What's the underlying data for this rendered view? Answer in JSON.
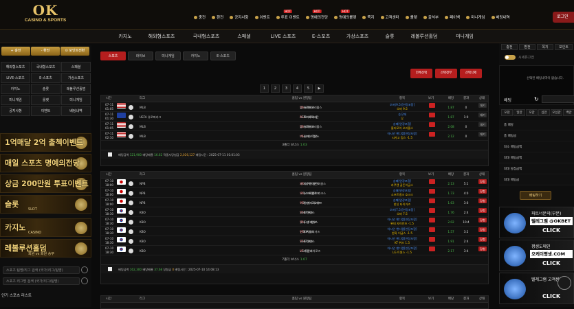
{
  "logo": {
    "big": "OK",
    "small": "CASINO & SPORTS"
  },
  "topnav": [
    {
      "label": "충전",
      "hot": ""
    },
    {
      "label": "환전",
      "hot": ""
    },
    {
      "label": "공지사항",
      "hot": ""
    },
    {
      "label": "이벤트",
      "hot": ""
    },
    {
      "label": "투표 이벤트",
      "hot": "HOT"
    },
    {
      "label": "명예의전당",
      "hot": "HOT"
    },
    {
      "label": "명예의룰렛",
      "hot": "HOT"
    },
    {
      "label": "쪽지",
      "hot": ""
    },
    {
      "label": "고객센터",
      "hot": ""
    },
    {
      "label": "룰렛",
      "hot": ""
    },
    {
      "label": "출석부",
      "hot": ""
    },
    {
      "label": "페이백",
      "hot": ""
    },
    {
      "label": "미니게임",
      "hot": ""
    },
    {
      "label": "베팅내역",
      "hot": ""
    }
  ],
  "login_label": "로그인",
  "mainnav": [
    "카지노",
    "해외형스포츠",
    "국내형스포츠",
    "스페셜",
    "LIVE 스포츠",
    "E-스포츠",
    "가상스포츠",
    "슬롯",
    "레볼루션홀덤",
    "미니게임"
  ],
  "left": {
    "top_buttons": [
      "+ 충전",
      "- 환전",
      "⊙ 포인트전환"
    ],
    "sports": [
      "해외형스포츠",
      "국내형스포츠",
      "스페셜",
      "LIVE-스포츠",
      "E-스포츠",
      "가상스포츠",
      "카지노",
      "슬롯",
      "레볼루션홀덤",
      "미니게임",
      "룰렛",
      "미니게임",
      "공지사항",
      "이벤트",
      "베팅내역"
    ],
    "banners": [
      {
        "title": "1억매달 2억 출첵이벤트",
        "sub": ""
      },
      {
        "title": "매일 스포츠 명예의전당",
        "sub": ""
      },
      {
        "title": "상금 200만원 투표이벤트",
        "sub": ""
      },
      {
        "title": "슬롯",
        "sub": "SLOT"
      },
      {
        "title": "카지노",
        "sub": "CASINO"
      },
      {
        "title": "레볼루션홀덤",
        "sub": "회원 vs 회원 승부"
      }
    ],
    "search1_placeholder": "스포츠 팀명/리그 검색 (국가/리그/팀명)",
    "search2_placeholder": "스포츠 리그명 검색 (국가/리그/팀명)",
    "popular_label": "인기 스포츠 리스트"
  },
  "tabs": [
    "스포츠",
    "라이브",
    "미니게임",
    "카지노",
    "E-스포츠"
  ],
  "red_buttons": [
    "전체선택",
    "선택정부",
    "선택삭제"
  ],
  "pager": [
    "1",
    "2",
    "3",
    "4",
    "5",
    "▶"
  ],
  "columns": [
    "시간",
    "리그",
    "홈팀 vs 원정팀",
    "항목",
    "보기",
    "배당",
    "결과",
    "상태"
  ],
  "table1": {
    "rows": [
      {
        "time": [
          "07-11",
          "01:05"
        ],
        "flag": "us",
        "league": "MLB",
        "home": "볼티모어 오리올스",
        "away": "뉴욕메츠",
        "sel": [
          "오버(9.5)[연장포함]",
          "오버 9.5"
        ],
        "odds": "1.87",
        "result": "0",
        "status": "대기"
      },
      {
        "time": [
          "07-11",
          "01:30"
        ],
        "flag": "eu",
        "league": "UEFA 유로파리그",
        "home": "AEK 라르나카",
        "away": "FK 파르티잔",
        "sel": [
          "승무패",
          "무"
        ],
        "odds": "1.87",
        "result": "1:0",
        "status": "대기"
      },
      {
        "time": [
          "07-11",
          "01:05"
        ],
        "flag": "us",
        "league": "MLB",
        "home": "볼티모어 오리올스",
        "away": "뉴욕메츠",
        "sel": [
          "승패[연장포함]",
          "볼티모어 오리올스"
        ],
        "odds": "2.08",
        "result": "0",
        "status": "대기"
      },
      {
        "time": [
          "07-11",
          "02:10"
        ],
        "flag": "us",
        "league": "MLB",
        "home": "미네소타 트윈스",
        "away": "시카고 컵스",
        "sel": [
          "아시안 핸디캡[연장포함]",
          "시카고 컵스 -1.5"
        ],
        "odds": "2.12",
        "result": "0",
        "status": "대기"
      }
    ],
    "bonus": "3폴더 보너스",
    "bonus_value": "1.03",
    "summary": {
      "bet_label": "배팅금액",
      "bet": "121,900",
      "odds_label": "배당배율",
      "odds": "16.62",
      "win_label": "적중시당첨금",
      "win": "2,026,127",
      "time": "배팅시간 : 2025-07-11 01:01:03"
    }
  },
  "table2": {
    "rows": [
      {
        "time": [
          "07-10",
          "18:00"
        ],
        "flag": "jp",
        "league": "NPB",
        "home": "세이부 라이온즈",
        "away": "라쿠텐 골든이글스",
        "sel": [
          "승패[연장포함]",
          "라쿠텐 골든이글스"
        ],
        "odds": "2.13",
        "result": "5:1",
        "status": "당첨"
      },
      {
        "time": [
          "07-10",
          "18:00"
        ],
        "flag": "jp",
        "league": "NPB",
        "home": "오릭스 버팔로즈",
        "away": "소프트뱅크 호크스",
        "sel": [
          "승패[연장포함]",
          "소프트뱅크 호크스"
        ],
        "odds": "1.73",
        "result": "4:0",
        "status": "당첨"
      },
      {
        "time": [
          "07-10",
          "18:00"
        ],
        "flag": "jp",
        "league": "NPB",
        "home": "히로시마 도요카프",
        "away": "한신 타이거즈",
        "sel": [
          "승패[연장포함]",
          "한신 타이거즈"
        ],
        "odds": "1.63",
        "result": "3:6",
        "status": "당첨"
      },
      {
        "time": [
          "07-10",
          "18:30"
        ],
        "flag": "kr",
        "league": "KBO",
        "home": "SSG 랜더스",
        "away": "KT 위즈",
        "sel": [
          "오버(7.5)[연장포함]",
          "오버 7.5"
        ],
        "odds": "1.76",
        "result": "2:4",
        "status": "당첨"
      },
      {
        "time": [
          "07-10",
          "18:30"
        ],
        "flag": "kr",
        "league": "KBO",
        "home": "롯데 자이언츠",
        "away": "두산 베어스",
        "sel": [
          "아시안 핸디캡[연장포함]",
          "롯데 자이언츠 -1.5"
        ],
        "odds": "2.02",
        "result": "10:4",
        "status": "당첨"
      },
      {
        "time": [
          "07-10",
          "18:30"
        ],
        "flag": "kr",
        "league": "KBO",
        "home": "한화 이글스",
        "away": "KIA 타이거즈",
        "sel": [
          "아시안 핸디캡[연장포함]",
          "한화 이글스 -1.5"
        ],
        "odds": "1.57",
        "result": "3:2",
        "status": "당첨"
      },
      {
        "time": [
          "07-10",
          "18:30"
        ],
        "flag": "kr",
        "league": "KBO",
        "home": "SSG 랜더스",
        "away": "KT 위즈",
        "sel": [
          "아시안 핸디캡[연장포함]",
          "KT 위즈 1.5"
        ],
        "odds": "1.91",
        "result": "2:4",
        "status": "당첨"
      },
      {
        "time": [
          "07-10",
          "18:30"
        ],
        "flag": "kr",
        "league": "KBO",
        "home": "LG 트윈스",
        "away": "키움 히어로즈",
        "sel": [
          "아시안 핸디캡[연장포함]",
          "LG 트윈스 -1.5"
        ],
        "odds": "2.17",
        "result": "3:4",
        "status": "당첨"
      }
    ],
    "bonus": "7폴더 보너스",
    "bonus_value": "1.07",
    "summary": {
      "bet_label": "배팅금액",
      "bet": "162,300",
      "odds_label": "배당배율",
      "odds": "37.68",
      "win_label": "당첨금",
      "win": "0",
      "time": "배팅시간 : 2025-07-10 14:08:13"
    }
  },
  "table3_columns": [
    "시간",
    "리그",
    "홈팀 vs 원정팀",
    "항목",
    "보기",
    "배당",
    "결과",
    "상태"
  ],
  "right": {
    "top": [
      "충전",
      "환전",
      "쪽지",
      "포인트"
    ],
    "note": "시세유고전",
    "panel_msg": "선택된 배팅내역이 없습니다.",
    "bet_label": "배팅",
    "chips": [
      "오천",
      "일만",
      "오만",
      "십만",
      "오십만",
      "백만"
    ],
    "lines": [
      "총 배당",
      "총 배팅금",
      "최소 배팅금액",
      "최대 배팅금액",
      "최대 당첨금액",
      "최대 베팅금"
    ],
    "bet_button": "배팅하기",
    "promos": [
      {
        "head": "파트너문의(부분)",
        "title": "텔레그램 @OKBET",
        "cta": "CLICK"
      },
      {
        "head": "평생도메인",
        "title": "오케이평생.COM",
        "cta": "CLICK"
      },
      {
        "head": "텔레그램 고객센터",
        "title": "",
        "cta": "CLICK"
      }
    ]
  }
}
